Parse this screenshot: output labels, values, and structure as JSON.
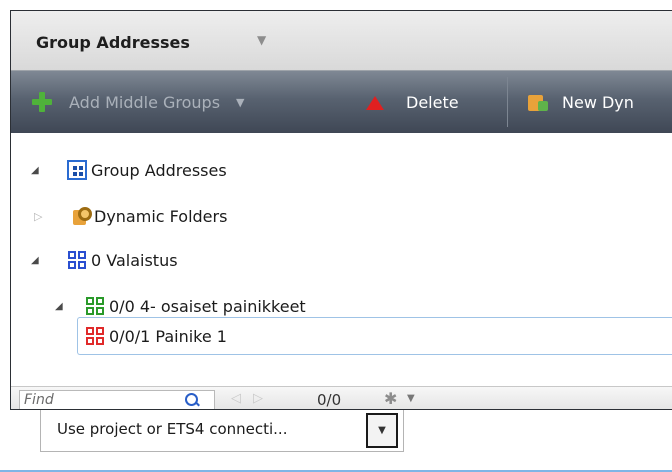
{
  "panel": {
    "title": "Group Addresses",
    "title_dropdown_icon": "caret-down-icon"
  },
  "toolbar": {
    "add_middle_groups_label": "Add Middle Groups",
    "delete_label": "Delete",
    "new_dynamic_label": "New Dyn"
  },
  "tree": {
    "root": {
      "label": "Group Addresses",
      "icon": "group-addresses-icon"
    },
    "dynamic_folders": {
      "label": "Dynamic Folders",
      "icon": "dynamic-folder-icon"
    },
    "main_group": {
      "label": "0 Valaistus",
      "icon": "main-group-icon",
      "color": "#2a4fd0"
    },
    "middle_group": {
      "label": "0/0 4- osaiset painikkeet",
      "icon": "middle-group-icon",
      "color": "#2a9a2a"
    },
    "group_address": {
      "label": "0/0/1 Painike 1",
      "icon": "group-address-icon",
      "color": "#e02a2a",
      "selected": true
    }
  },
  "findbar": {
    "placeholder": "Find",
    "count": "0/0"
  },
  "connection": {
    "selected_value": "Use project or ETS4 connecti..."
  },
  "colors": {
    "toolbar_bg": "#586270",
    "add_icon": "#4fb23a",
    "delete_icon": "#e02020",
    "selection_border": "#9fc3e6"
  }
}
